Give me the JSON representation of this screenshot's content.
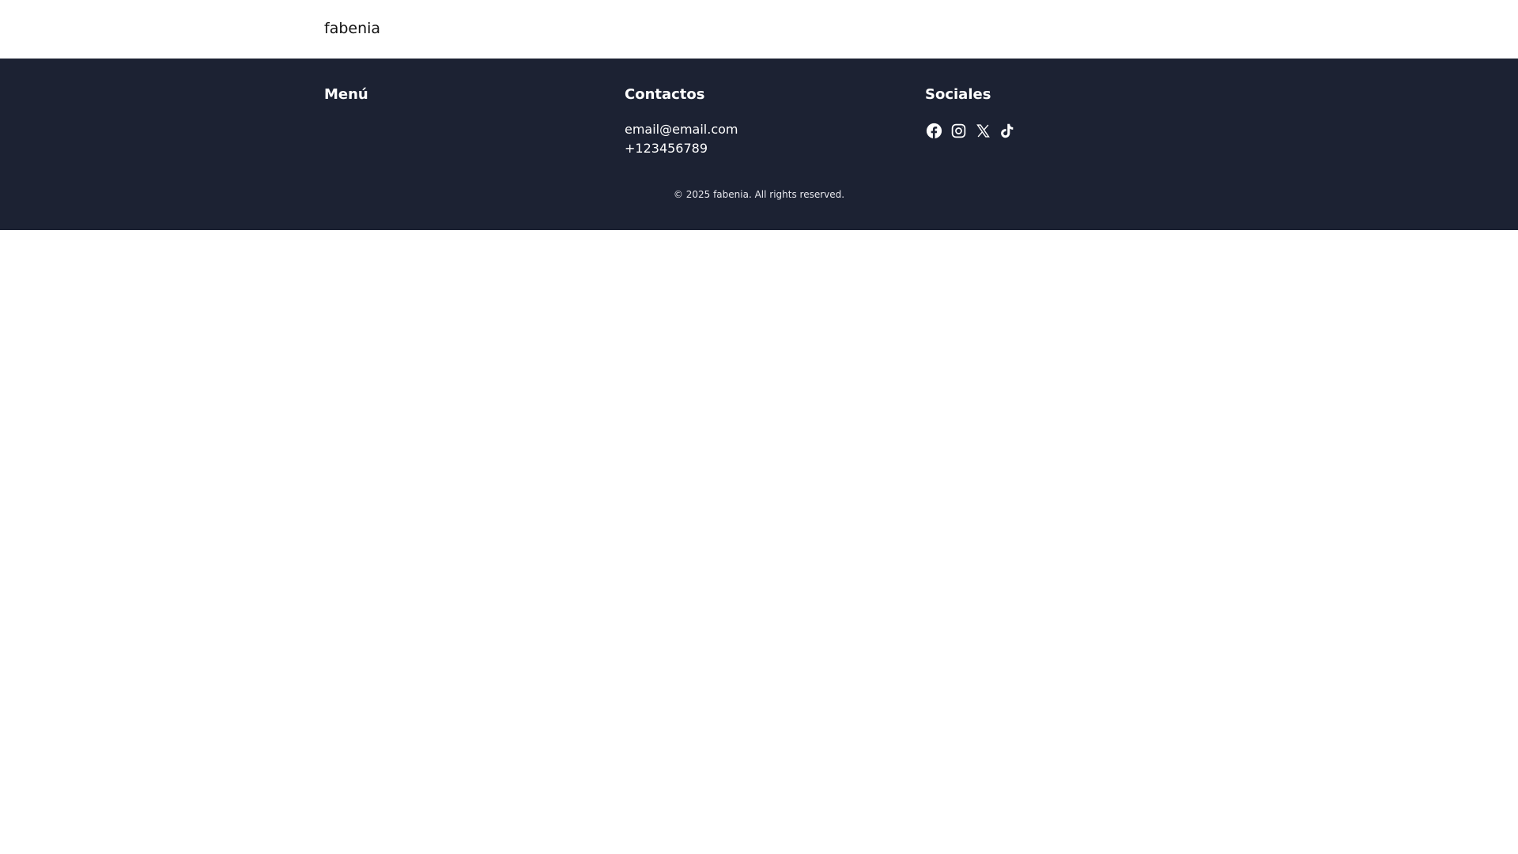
{
  "header": {
    "brand": "fabenia"
  },
  "footer": {
    "menu": {
      "title": "Menú"
    },
    "contact": {
      "title": "Contactos",
      "email": "email@email.com",
      "phone": "+123456789"
    },
    "social": {
      "title": "Sociales",
      "icons": [
        "facebook-icon",
        "instagram-icon",
        "x-icon",
        "tiktok-icon"
      ]
    },
    "copyright": "© 2025 fabenia. All rights reserved."
  },
  "colors": {
    "footer_background": "#1c2233",
    "footer_text": "#ffffff",
    "page_background": "#ffffff"
  }
}
